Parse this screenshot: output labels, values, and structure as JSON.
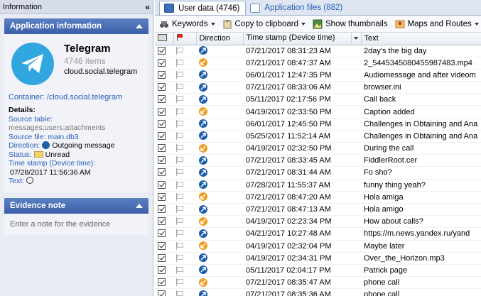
{
  "left": {
    "pane_title": "Information",
    "collapse_glyph": "«",
    "app_section": {
      "title": "Application information",
      "app_name": "Telegram",
      "item_count": "4746 items",
      "package": "cloud.social.telegram",
      "container_label": "Container:",
      "container_value": "/cloud.social.telegram",
      "details_label": "Details:",
      "source_table_label": "Source table:",
      "source_table_value": "messages;users;attachments",
      "source_file_label": "Source file:",
      "source_file_value": "main.db3",
      "direction_label": "Direction:",
      "direction_value": "Outgoing message",
      "status_label": "Status:",
      "status_value": "Unread",
      "timestamp_label": "Time stamp (Device time):",
      "timestamp_value": "07/28/2017 11:56:36 AM",
      "text_label": "Text:"
    },
    "evidence_section": {
      "title": "Evidence note",
      "placeholder": "Enter a note for the evidence"
    }
  },
  "tabs": [
    {
      "label": "User data (4746)",
      "active": true
    },
    {
      "label": "Application files (882)",
      "active": false
    }
  ],
  "toolbar": {
    "keywords": "Keywords",
    "copy": "Copy to clipboard",
    "thumbnails": "Show thumbnails",
    "maps": "Maps and Routes"
  },
  "columns": {
    "direction": "Direction",
    "timestamp": "Time stamp (Device time)",
    "text": "Text"
  },
  "rows": [
    {
      "dir": "out",
      "time": "07/21/2017 08:31:23 AM",
      "text": "2day's the big day"
    },
    {
      "dir": "in",
      "time": "07/21/2017 08:47:37 AM",
      "text": "2_5445345080455987483.mp4"
    },
    {
      "dir": "out",
      "time": "06/01/2017 12:47:35 PM",
      "text": "Audiomessage and after videom"
    },
    {
      "dir": "out",
      "time": "07/21/2017 08:33:06 AM",
      "text": "browser.ini"
    },
    {
      "dir": "out",
      "time": "05/11/2017 02:17:56 PM",
      "text": "Call back"
    },
    {
      "dir": "in",
      "time": "04/19/2017 02:33:50 PM",
      "text": "Caption added"
    },
    {
      "dir": "out",
      "time": "06/01/2017 12:45:50 PM",
      "text": "Challenges in Obtaining and Ana"
    },
    {
      "dir": "out",
      "time": "05/25/2017 11:52:14 AM",
      "text": "Challenges in Obtaining and Ana"
    },
    {
      "dir": "in",
      "time": "04/19/2017 02:32:50 PM",
      "text": "During the call"
    },
    {
      "dir": "out",
      "time": "07/21/2017 08:33:45 AM",
      "text": "FiddlerRoot.cer"
    },
    {
      "dir": "out",
      "time": "07/21/2017 08:31:44 AM",
      "text": "Fo sho?"
    },
    {
      "dir": "out",
      "time": "07/28/2017 11:55:37 AM",
      "text": "funny thing yeah?"
    },
    {
      "dir": "in",
      "time": "07/21/2017 08:47:20 AM",
      "text": "Hola amiga"
    },
    {
      "dir": "out",
      "time": "07/21/2017 08:47:13 AM",
      "text": "Hola amigo"
    },
    {
      "dir": "in",
      "time": "04/19/2017 02:23:34 PM",
      "text": "How about calls?"
    },
    {
      "dir": "out",
      "time": "04/21/2017 10:27:48 AM",
      "text": "https://m.news.yandex.ru/yand"
    },
    {
      "dir": "in",
      "time": "04/19/2017 02:32:04 PM",
      "text": "Maybe later"
    },
    {
      "dir": "out",
      "time": "04/19/2017 02:34:31 PM",
      "text": "Over_the_Horizon.mp3"
    },
    {
      "dir": "out",
      "time": "05/11/2017 02:04:17 PM",
      "text": "Patrick page"
    },
    {
      "dir": "in",
      "time": "07/21/2017 08:35:47 AM",
      "text": "phone call"
    },
    {
      "dir": "out",
      "time": "07/21/2017 08:35:36 AM",
      "text": "phone call"
    }
  ]
}
